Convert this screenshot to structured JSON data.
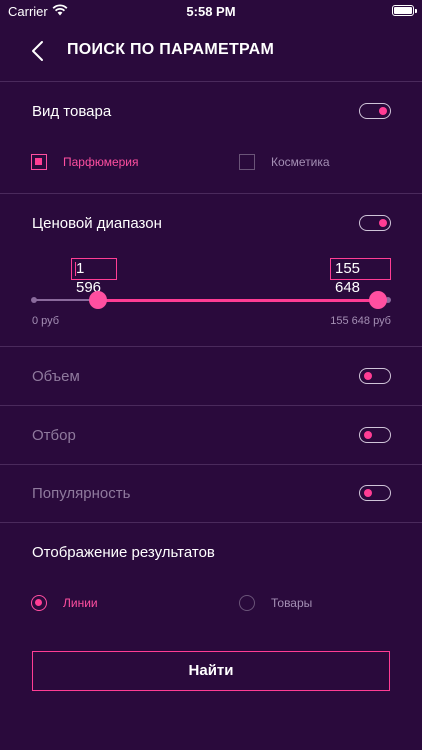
{
  "status_bar": {
    "carrier": "Carrier",
    "time": "5:58 PM"
  },
  "nav": {
    "title": "ПОИСК ПО ПАРАМЕТРАМ",
    "back_icon": "chevron-left-icon"
  },
  "product_type": {
    "label": "Вид товара",
    "enabled": true,
    "options": [
      {
        "label": "Парфюмерия",
        "checked": true
      },
      {
        "label": "Косметика",
        "checked": false
      }
    ]
  },
  "price_range": {
    "label": "Ценовой диапазон",
    "enabled": true,
    "min_value": "1 596",
    "max_value": "155 648",
    "min_label": "0 руб",
    "max_label": "155 648 руб",
    "slider_min": 0,
    "slider_max": 155648,
    "selected_min": 1596,
    "selected_max": 155648
  },
  "volume": {
    "label": "Объем",
    "enabled": false
  },
  "selection": {
    "label": "Отбор",
    "enabled": false
  },
  "popularity": {
    "label": "Популярность",
    "enabled": false
  },
  "display": {
    "label": "Отображение результатов",
    "options": [
      {
        "label": "Линии",
        "selected": true
      },
      {
        "label": "Товары",
        "selected": false
      }
    ]
  },
  "find_button": {
    "label": "Найти"
  },
  "colors": {
    "accent": "#ff3d94",
    "background": "#2a0a3c",
    "divider": "#4a2a5c",
    "muted": "#8f7a9d"
  }
}
